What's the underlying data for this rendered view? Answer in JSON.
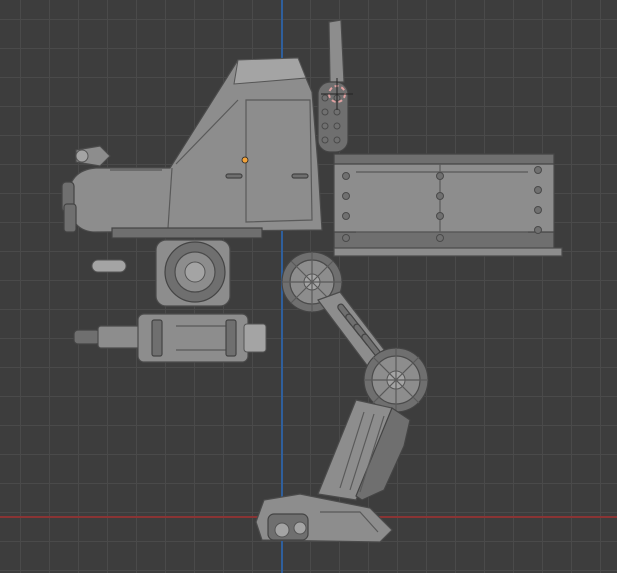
{
  "viewport": {
    "title": "",
    "background": "#3d3d3d",
    "grid_color": "#4a4a4a",
    "x_axis_color": "#8a3434",
    "y_axis_color": "#2f5f9c",
    "origin_color": "#f2a23a",
    "cursor_color": "#e0a0a0"
  },
  "scene": {
    "object": "mech-walker-model",
    "view": "side-orthographic"
  }
}
